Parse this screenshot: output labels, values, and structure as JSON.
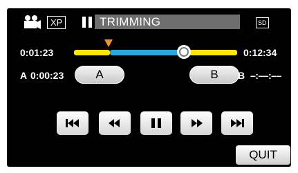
{
  "status_bar": {
    "mode_badge": "XP",
    "title": "TRIMMING",
    "media_badge": "SD",
    "camera_icon": "video-camera-icon",
    "pause_indicator_icon": "pause-icon"
  },
  "timeline": {
    "current_time": "0:01:23",
    "total_time": "0:12:34",
    "a_marker_position": 0.22,
    "playhead_position": 0.7,
    "colors": {
      "track": "#ffe600",
      "selected_range": "#29a8e0",
      "marker": "#f7941d"
    }
  },
  "trim_points": {
    "a_label": "A",
    "a_time": "0:00:23",
    "a_button_label": "A",
    "b_label": "B",
    "b_time": "–:––:––",
    "b_button_label": "B"
  },
  "transport": {
    "buttons": [
      "skip-to-start-icon",
      "rewind-icon",
      "pause-icon",
      "fast-forward-icon",
      "skip-to-end-icon"
    ]
  },
  "quit_label": "QUIT"
}
